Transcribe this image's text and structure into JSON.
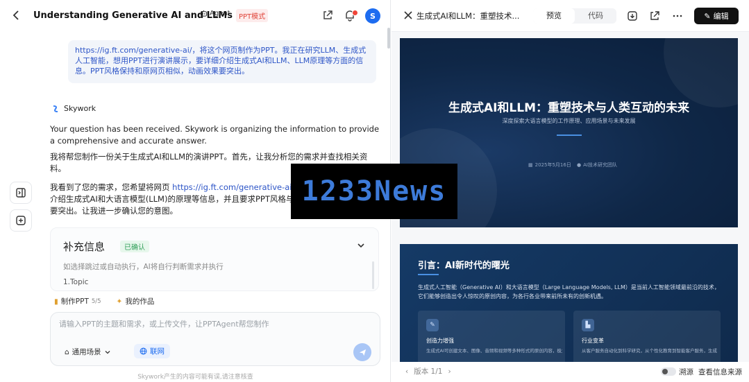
{
  "left": {
    "title": "Understanding Generative AI and LLMs",
    "agent_label": "Agent",
    "mode_tag": "PPT模式",
    "avatar_letter": "S",
    "user_message": {
      "link": "https://ig.ft.com/generative-ai/",
      "text": "，将这个网页制作为PPT。我正在研究LLM、生成式人工智能，想用PPT进行演讲展示，要详细介绍生成式AI和LLM、LLM原理等方面的信息。PPT风格保持和原网页相似，动画效果要突出。"
    },
    "assistant_name": "Skywork",
    "answer_1": "Your question has been received. Skywork is organizing the information to provide a comprehensive and accurate answer.",
    "answer_2": "我将帮您制作一份关于生成式AI和LLM的演讲PPT。首先，让我分析您的需求并查找相关资料。",
    "answer_3_pre": "我看到了您的需求，您希望将网页 ",
    "answer_3_link": "https://ig.ft.com/generative-ai/",
    "answer_3_post": " 转",
    "answer_3_line2": "介绍生成式AI和大语言模型(LLM)的原理等信息，并且要求PPT风格与",
    "answer_3_line3": "要突出。让我进一步确认您的意图。",
    "supplement": {
      "title": "补充信息",
      "badge": "已确认",
      "desc": "如选择跳过或自动执行，AI将自行判断需求并执行",
      "topic": "1.Topic"
    },
    "chips": [
      {
        "label": "制作PPT",
        "count": "5/5"
      },
      {
        "label": "我的作品",
        "count": ""
      }
    ],
    "input_placeholder": "请输入PPT的主题和需求，或上传文件，让PPTAgent帮您制作",
    "scene_label": "通用场景",
    "network_label": "联网",
    "disclaimer": "Skywork产生的内容可能有误,请注意核查"
  },
  "right": {
    "title": "生成式AI和LLM：重塑技术...",
    "tabs": [
      {
        "label": "预览",
        "active": true
      },
      {
        "label": "代码",
        "active": false
      }
    ],
    "edit_label": "编辑",
    "slide1": {
      "title": "生成式AI和LLM：重塑技术与人类互动的未来",
      "subtitle": "深度探索大语言模型的工作原理、应用场景与未来发展",
      "date": "2025年5月16日",
      "author": "AI技术研究团队"
    },
    "slide2": {
      "title": "引言：AI新时代的曙光",
      "body": "生成式人工智能（Generative AI）和大语言模型（Large Language Models, LLM）是当前人工智能领域最前沿的技术，它们能够创造出令人惊叹的原创内容，为各行各业带来前所未有的创新机遇。",
      "cards": [
        {
          "icon": "brush-icon",
          "title": "创造力增强",
          "text": "生成式AI可创建文本、图像、音频和视频等多种形式的原创内容，极大"
        },
        {
          "icon": "factory-icon",
          "title": "行业变革",
          "text": "从客户服务自动化到科学研究，从个性化教育到智能客户服务，生成"
        }
      ]
    },
    "pager": "版本 1/1",
    "trace_label": "溯源",
    "source_link": "查看信息来源"
  },
  "watermark": "1233News",
  "colors": {
    "accent": "#1d6cf0",
    "mode_red": "#e0453a",
    "slide_bg": "#0f2747",
    "watermark_text": "#3d7bd9"
  }
}
